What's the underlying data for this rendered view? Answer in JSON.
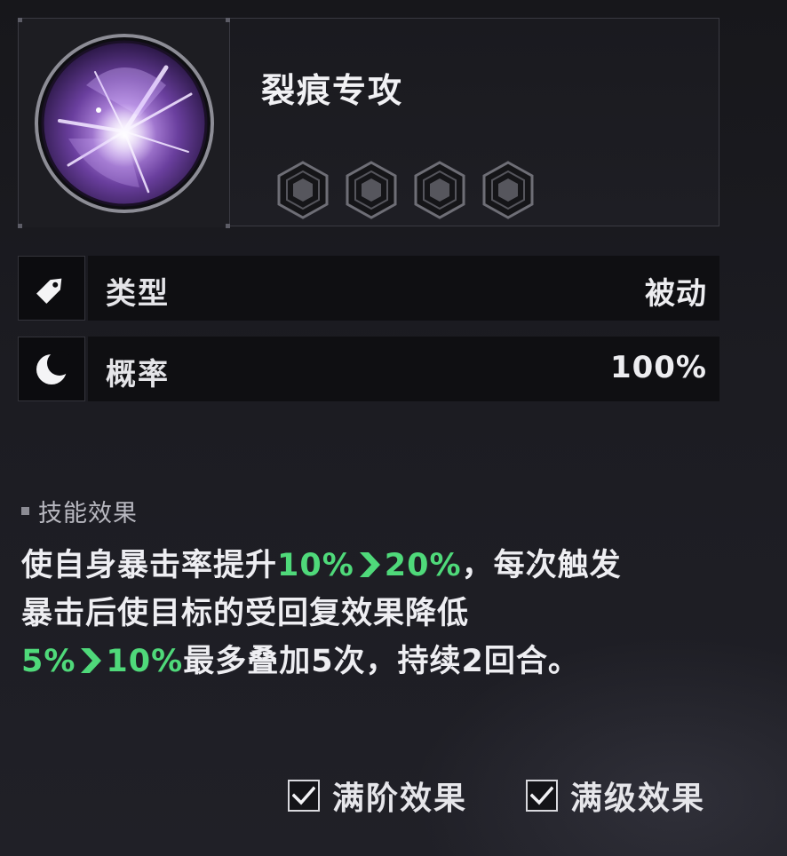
{
  "skill": {
    "name": "裂痕专攻",
    "icon": "purple-crack-orb-icon",
    "level_slots": 4
  },
  "stats": {
    "type_label": "类型",
    "type_value": "被动",
    "type_icon": "tag-icon",
    "prob_label": "概率",
    "prob_value": "100%",
    "prob_icon": "crescent-moon-icon"
  },
  "effect": {
    "heading": "技能效果",
    "line1_a": "使自身暴击率提升",
    "line1_from": "10%",
    "line1_to": "20%",
    "line1_b": "，每次触发",
    "line2": "暴击后使目标的受回复效果降低",
    "line3_from": "5%",
    "line3_to": "10%",
    "line3_b": "最多叠加5次，持续2回合。"
  },
  "toggles": {
    "full_rank_label": "满阶效果",
    "full_rank_checked": true,
    "full_level_label": "满级效果",
    "full_level_checked": true
  },
  "colors": {
    "highlight": "#4fd97a",
    "accent_purple": "#a77bd8"
  }
}
